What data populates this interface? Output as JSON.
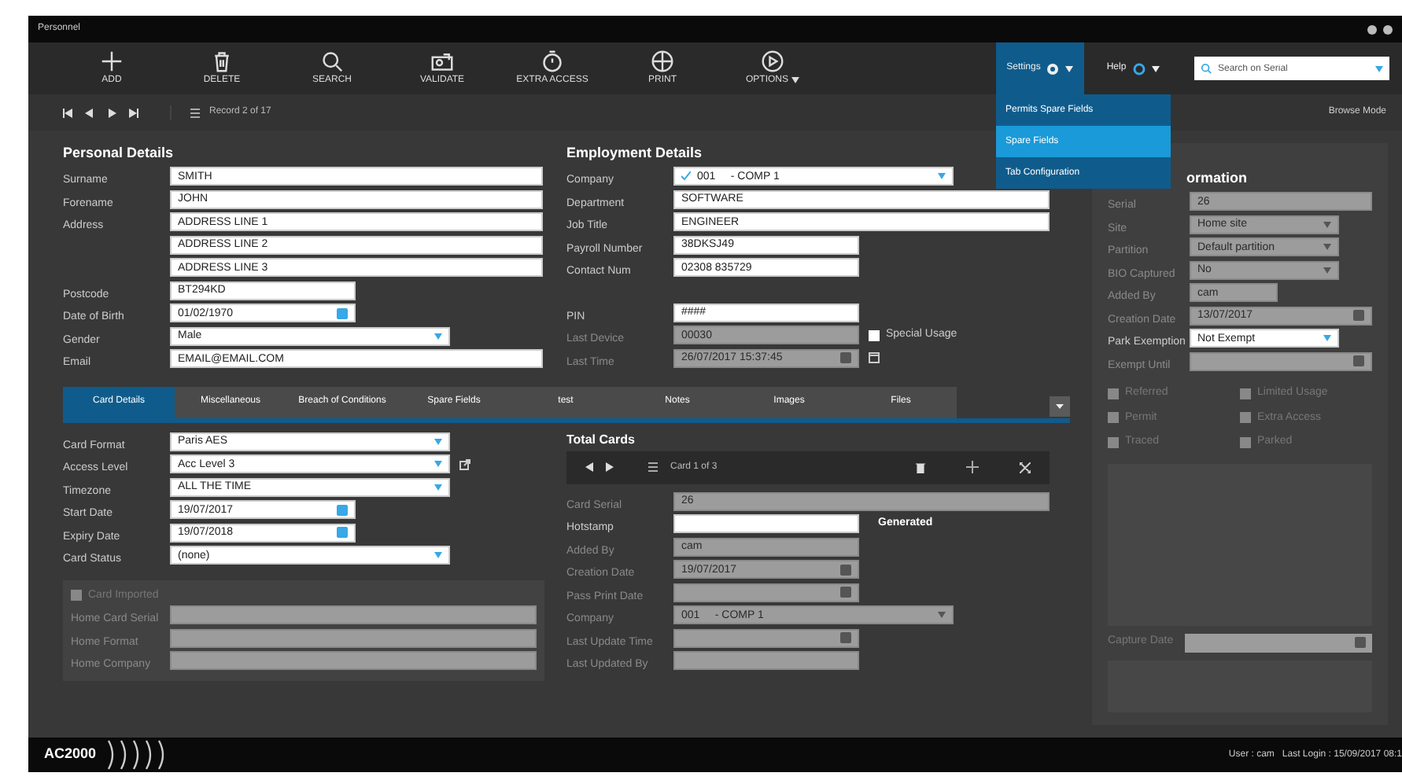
{
  "window": {
    "title": "Personnel"
  },
  "toolbar": [
    {
      "label": "ADD"
    },
    {
      "label": "DELETE"
    },
    {
      "label": "SEARCH"
    },
    {
      "label": "VALIDATE"
    },
    {
      "label": "EXTRA ACCESS"
    },
    {
      "label": "PRINT"
    },
    {
      "label": "OPTIONS",
      "has_menu": true
    }
  ],
  "settings_menu": {
    "label": "Settings",
    "expanded": true,
    "items": [
      {
        "label": "Permits Spare Fields",
        "selected": false
      },
      {
        "label": "Spare Fields",
        "selected": true
      },
      {
        "label": "Tab Configuration",
        "selected": false
      }
    ]
  },
  "help": {
    "label": "Help"
  },
  "search": {
    "placeholder": "Search on Serial"
  },
  "record_bar": {
    "record": "Record 2 of 17",
    "mode": "Browse Mode"
  },
  "personal_details": {
    "title": "Personal Details",
    "fields": [
      {
        "label": "Surname",
        "value": "SMITH",
        "kind": "text"
      },
      {
        "label": "Forename",
        "value": "JOHN",
        "kind": "text"
      },
      {
        "label": "Address",
        "value": "ADDRESS LINE 1",
        "kind": "text"
      },
      {
        "value": "ADDRESS LINE 2",
        "kind": "text"
      },
      {
        "value": "ADDRESS LINE 3",
        "kind": "text"
      },
      {
        "label": "Postcode",
        "value": "BT294KD",
        "kind": "text"
      },
      {
        "label": "Date of Birth",
        "value": "01/02/1970",
        "kind": "date"
      },
      {
        "label": "Gender",
        "value": "Male",
        "kind": "select"
      },
      {
        "label": "Email",
        "value": "EMAIL@EMAIL.COM",
        "kind": "text"
      }
    ]
  },
  "employment_details": {
    "title": "Employment Details",
    "fields": [
      {
        "label": "Company",
        "value": "001     - COMP 1",
        "kind": "company",
        "disabled": false
      },
      {
        "label": "Department",
        "value": "SOFTWARE",
        "kind": "text",
        "disabled": false
      },
      {
        "label": "Job Title",
        "value": "ENGINEER",
        "kind": "text",
        "disabled": false
      },
      {
        "label": "Payroll Number",
        "value": "38DKSJ49",
        "kind": "text",
        "disabled": false
      },
      {
        "label": "Contact Num",
        "value": "02308 835729",
        "kind": "text",
        "disabled": false
      },
      {
        "label": "PIN",
        "value": "####",
        "kind": "text",
        "disabled": false
      },
      {
        "label": "Last Device",
        "value": "00030",
        "kind": "text",
        "disabled": true
      },
      {
        "label": "Last Time",
        "value": "26/07/2017 15:37:45",
        "kind": "date",
        "disabled": true
      }
    ],
    "special_usage": {
      "label": "Special Usage",
      "checked": false
    }
  },
  "card_information": {
    "title": "ormation",
    "fields": [
      {
        "label": "Serial",
        "value": "26",
        "kind": "text",
        "disabled": true
      },
      {
        "label": "Site",
        "value": "Home site",
        "kind": "select",
        "disabled": true
      },
      {
        "label": "Partition",
        "value": "Default partition",
        "kind": "select",
        "disabled": true
      },
      {
        "label": "BIO Captured",
        "value": "No",
        "kind": "select",
        "disabled": true
      },
      {
        "label": "Added By",
        "value": "cam",
        "kind": "text",
        "disabled": true
      },
      {
        "label": "Creation Date",
        "value": "13/07/2017",
        "kind": "date",
        "disabled": true
      },
      {
        "label": "Park Exemption",
        "value": "Not Exempt",
        "kind": "select",
        "disabled": false
      },
      {
        "label": "Exempt Until",
        "kind": "date",
        "disabled": true
      }
    ],
    "flags": [
      {
        "label": "Referred",
        "checked": false
      },
      {
        "label": "Limited Usage",
        "checked": false
      },
      {
        "label": "Permit",
        "checked": false
      },
      {
        "label": "Extra Access",
        "checked": false
      },
      {
        "label": "Traced",
        "checked": false
      },
      {
        "label": "Parked",
        "checked": false
      }
    ],
    "capture_date": {
      "label": "Capture Date"
    }
  },
  "tabs": [
    {
      "label": "Card Details",
      "selected": true
    },
    {
      "label": "Miscellaneous",
      "selected": false
    },
    {
      "label": "Breach of Conditions",
      "selected": false
    },
    {
      "label": "Spare Fields",
      "selected": false
    },
    {
      "label": "test",
      "selected": false
    },
    {
      "label": "Notes",
      "selected": false
    },
    {
      "label": "Images",
      "selected": false
    },
    {
      "label": "Files",
      "selected": false
    }
  ],
  "card_details": {
    "fields": [
      {
        "label": "Card Format",
        "value": "Paris AES",
        "kind": "select"
      },
      {
        "label": "Access Level",
        "value": "Acc Level 3",
        "kind": "select"
      },
      {
        "label": "Timezone",
        "value": "ALL THE TIME",
        "kind": "select"
      },
      {
        "label": "Start Date",
        "value": "19/07/2017",
        "kind": "date"
      },
      {
        "label": "Expiry Date",
        "value": "19/07/2018",
        "kind": "date"
      },
      {
        "label": "Card Status",
        "value": "(none)",
        "kind": "select"
      }
    ],
    "card_imported": {
      "label": "Card Imported",
      "checked": false,
      "fields": [
        {
          "label": "Home Card Serial",
          "disabled": true
        },
        {
          "label": "Home Format",
          "disabled": true
        },
        {
          "label": "Home Company",
          "disabled": true
        }
      ]
    }
  },
  "total_cards": {
    "title": "Total Cards",
    "record": "Card 1 of 3",
    "fields": [
      {
        "label": "Card Serial",
        "value": "26",
        "kind": "text",
        "disabled": true
      },
      {
        "label": "Hotstamp",
        "kind": "text",
        "disabled": false,
        "note": "Generated"
      },
      {
        "label": "Added By",
        "value": "cam",
        "kind": "text",
        "disabled": true
      },
      {
        "label": "Creation Date",
        "value": "19/07/2017",
        "kind": "date",
        "disabled": true
      },
      {
        "label": "Pass Print Date",
        "kind": "date",
        "disabled": true
      },
      {
        "label": "Company",
        "value": "001     - COMP 1",
        "kind": "select",
        "disabled": true
      },
      {
        "label": "Last Update Time",
        "kind": "date",
        "disabled": true
      },
      {
        "label": "Last Updated By",
        "kind": "text",
        "disabled": true
      }
    ]
  },
  "footer": {
    "brand": "AC2000",
    "status": "User : cam   Last Login : 15/09/2017 08:1"
  }
}
